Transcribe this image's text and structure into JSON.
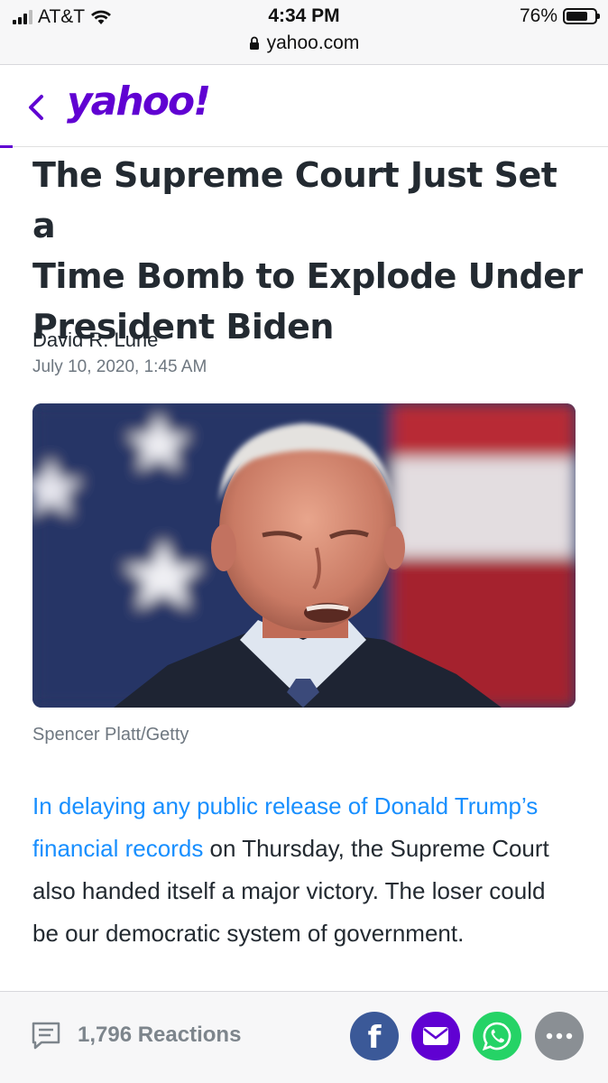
{
  "status_bar": {
    "carrier": "AT&T",
    "time": "4:34 PM",
    "battery": "76%",
    "battery_level": 0.76,
    "url": "yahoo.com"
  },
  "header": {
    "logo": "yahoo!",
    "back_icon": "chevron-left-icon",
    "brand_color": "#6001d2"
  },
  "article": {
    "headline_lines": [
      "The Supreme Court Just Set a",
      "Time Bomb to Explode Under",
      "President Biden"
    ],
    "author": "David R. Lurie",
    "date": "July 10, 2020, 1:45 AM",
    "photo_credit": "Spencer Platt/Getty",
    "body_link": "In delaying any public release of Donald Trump’s financial records",
    "body_rest": " on Thursday, the Supreme Court also handed itself a major victory. The loser could be our democratic system of government.",
    "link_color": "#188fff"
  },
  "footer": {
    "reactions": "1,796 Reactions",
    "reactions_icon": "comment-icon",
    "share_buttons": [
      {
        "icon": "facebook-icon",
        "color": "#3b5998"
      },
      {
        "icon": "mail-icon",
        "color": "#6001d2"
      },
      {
        "icon": "whatsapp-icon",
        "color": "#25d366"
      },
      {
        "icon": "more-icon",
        "color": "#8a8f94"
      }
    ]
  }
}
